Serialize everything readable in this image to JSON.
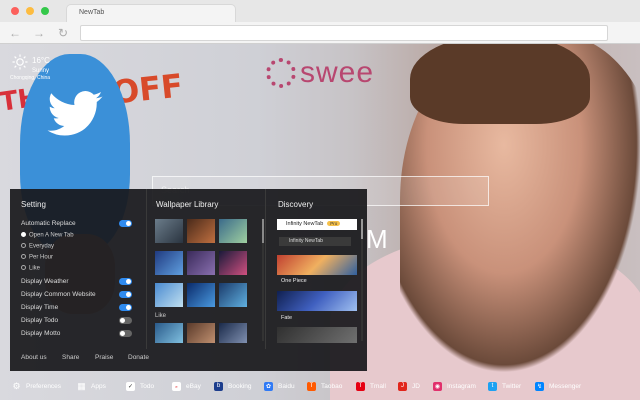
{
  "browser": {
    "tab_title": "NewTab",
    "address": ""
  },
  "weather": {
    "temperature": "16°C",
    "condition": "Sunny",
    "location": "Chongqing, China"
  },
  "wallpaper": {
    "brand_text": "swee",
    "sign_text": "OFF",
    "sign_text_left": "THE",
    "search_placeholder": "Search",
    "brand_letter": "M"
  },
  "setting": {
    "title": "Setting",
    "auto_replace_label": "Automatic Replace",
    "auto_replace_on": true,
    "replace_options": [
      {
        "label": "Open A New Tab",
        "selected": true
      },
      {
        "label": "Everyday",
        "selected": false
      },
      {
        "label": "Per Hour",
        "selected": false
      },
      {
        "label": "Like",
        "selected": false
      }
    ],
    "toggles": [
      {
        "label": "Display Weather",
        "on": true
      },
      {
        "label": "Display Common Website",
        "on": true
      },
      {
        "label": "Display Time",
        "on": true
      },
      {
        "label": "Display Todo",
        "on": false
      },
      {
        "label": "Display Motto",
        "on": false
      }
    ]
  },
  "wallpaper_library": {
    "title": "Wallpaper Library",
    "like_label": "Like"
  },
  "discovery": {
    "title": "Discovery",
    "top_item": "Infinity NewTab",
    "pro_badge": "Pro",
    "sub_item": "Infinity NewTab",
    "items": [
      "One Piece",
      "Fate"
    ]
  },
  "panel_footer": {
    "about": "About us",
    "share": "Share",
    "praise": "Praise",
    "donate": "Donate"
  },
  "dock": [
    {
      "label": "Preferences",
      "icon": "gear-icon",
      "color": "#00000000"
    },
    {
      "label": "Apps",
      "icon": "grid-icon",
      "color": "#00000000"
    },
    {
      "label": "Todo",
      "icon": "check-icon",
      "color": "#ffffff"
    },
    {
      "label": "eBay",
      "icon": "ebay-icon",
      "color": "#ffffff"
    },
    {
      "label": "Booking",
      "icon": "booking-icon",
      "color": "#1c3d8c"
    },
    {
      "label": "Baidu",
      "icon": "baidu-icon",
      "color": "#2f7af5"
    },
    {
      "label": "Taobao",
      "icon": "taobao-icon",
      "color": "#ff5a00"
    },
    {
      "label": "Tmall",
      "icon": "tmall-icon",
      "color": "#e60012"
    },
    {
      "label": "JD",
      "icon": "jd-icon",
      "color": "#e1251b"
    },
    {
      "label": "Instagram",
      "icon": "instagram-icon",
      "color": "#e1306c"
    },
    {
      "label": "Twitter",
      "icon": "twitter-icon",
      "color": "#1da1f2"
    },
    {
      "label": "Messenger",
      "icon": "messenger-icon",
      "color": "#0084ff"
    }
  ]
}
